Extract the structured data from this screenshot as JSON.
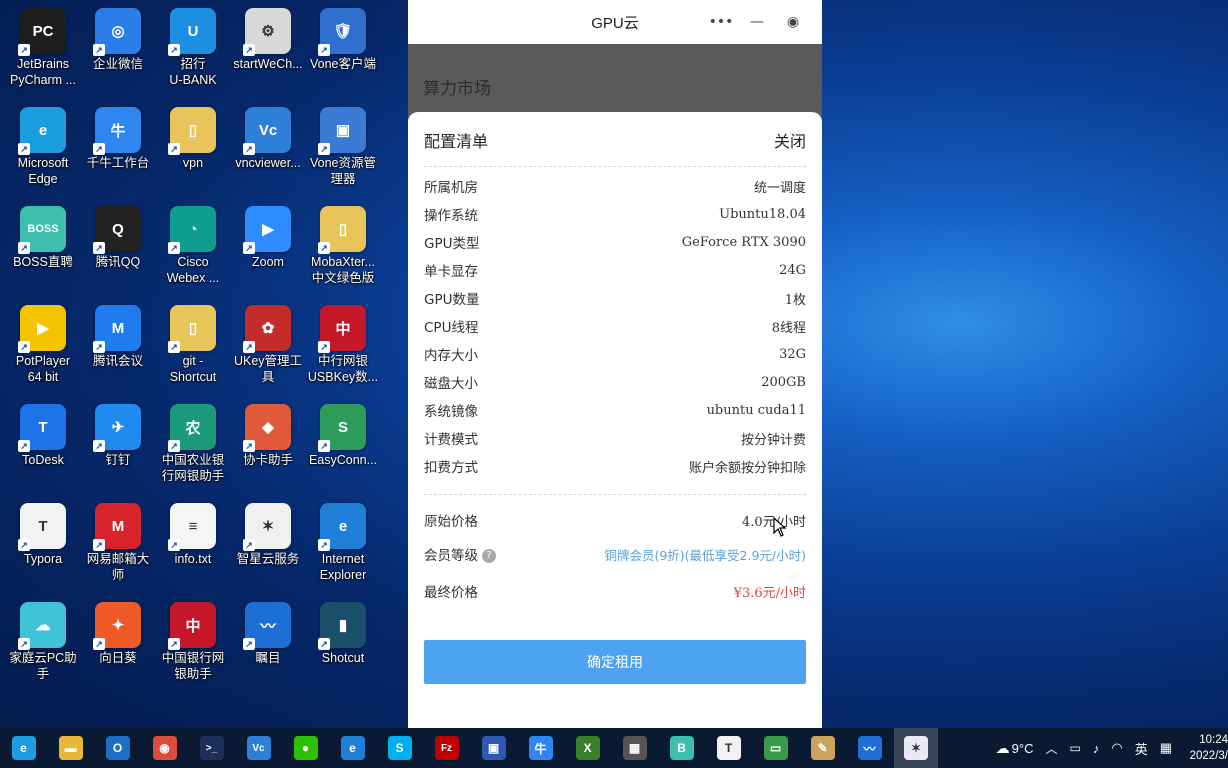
{
  "desktop_icons": [
    {
      "label": "JetBrains\nPyCharm ...",
      "color": "#1e1e1e",
      "glyph": "PC",
      "icon": "pycharm-icon"
    },
    {
      "label": "企业微信",
      "color": "#2b7de9",
      "glyph": "◎",
      "icon": "wecom-icon"
    },
    {
      "label": "招行\nU-BANK",
      "color": "#1d8fe1",
      "glyph": "U",
      "icon": "ubank-icon"
    },
    {
      "label": "startWeCh...",
      "color": "#d8d8d8",
      "glyph": "⚙",
      "icon": "settings-app-icon"
    },
    {
      "label": "Vone客户端",
      "color": "#2e6fcf",
      "glyph": "🛡",
      "icon": "shield-app-icon"
    },
    {
      "label": "Microsoft\nEdge",
      "color": "#1b9de2",
      "glyph": "e",
      "icon": "edge-icon"
    },
    {
      "label": "千牛工作台",
      "color": "#2f86f0",
      "glyph": "牛",
      "icon": "qianniu-icon"
    },
    {
      "label": "vpn",
      "color": "#e8c45a",
      "glyph": "▯",
      "icon": "folder-icon"
    },
    {
      "label": "vncviewer...",
      "color": "#2d7fd8",
      "glyph": "Vc",
      "icon": "vnc-icon"
    },
    {
      "label": "Vone资源管\n理器",
      "color": "#3a7bd5",
      "glyph": "▣",
      "icon": "vone-explorer-icon"
    },
    {
      "label": "BOSS直聘",
      "color": "#3dbfae",
      "glyph": "BOSS",
      "icon": "boss-icon"
    },
    {
      "label": "腾讯QQ",
      "color": "#222222",
      "glyph": "Q",
      "icon": "qq-icon"
    },
    {
      "label": "Cisco\nWebex ...",
      "color": "#0f9d8f",
      "glyph": "◔",
      "icon": "webex-icon"
    },
    {
      "label": "Zoom",
      "color": "#2d8cff",
      "glyph": "▶",
      "icon": "zoom-icon"
    },
    {
      "label": "MobaXter...\n中文绿色版",
      "color": "#e8c45a",
      "glyph": "▯",
      "icon": "folder-icon"
    },
    {
      "label": "PotPlayer\n64 bit",
      "color": "#f5c400",
      "glyph": "▶",
      "icon": "potplayer-icon"
    },
    {
      "label": "腾讯会议",
      "color": "#1e7bf0",
      "glyph": "M",
      "icon": "tencent-meeting-icon"
    },
    {
      "label": "git -\nShortcut",
      "color": "#e8c45a",
      "glyph": "▯",
      "icon": "folder-icon"
    },
    {
      "label": "UKey管理工\n具",
      "color": "#c42b2b",
      "glyph": "✿",
      "icon": "ukey-icon"
    },
    {
      "label": "中行网银\nUSBKey数...",
      "color": "#c4182a",
      "glyph": "中",
      "icon": "boc-icon"
    },
    {
      "label": "ToDesk",
      "color": "#1c74e8",
      "glyph": "T",
      "icon": "todesk-icon"
    },
    {
      "label": "钉钉",
      "color": "#1f8bf0",
      "glyph": "✈",
      "icon": "dingtalk-icon"
    },
    {
      "label": "中国农业银\n行网银助手",
      "color": "#1a9a7a",
      "glyph": "农",
      "icon": "abc-bank-icon"
    },
    {
      "label": "协卡助手",
      "color": "#e05a3a",
      "glyph": "◆",
      "icon": "xieka-icon"
    },
    {
      "label": "EasyConn...",
      "color": "#2d9c5a",
      "glyph": "S",
      "icon": "easyconnect-icon"
    },
    {
      "label": "Typora",
      "color": "#f2f2f2",
      "glyph": "T",
      "icon": "typora-icon"
    },
    {
      "label": "网易邮箱大\n师",
      "color": "#d8232a",
      "glyph": "M",
      "icon": "netease-mail-icon"
    },
    {
      "label": "info.txt",
      "color": "#f5f5f5",
      "glyph": "≡",
      "icon": "text-file-icon"
    },
    {
      "label": "智星云服务",
      "color": "#f0f0f0",
      "glyph": "✶",
      "icon": "zhixing-icon"
    },
    {
      "label": "Internet\nExplorer",
      "color": "#1f7fd6",
      "glyph": "e",
      "icon": "ie-icon"
    },
    {
      "label": "家庭云PC助\n手",
      "color": "#3ec4d6",
      "glyph": "☁",
      "icon": "homecloud-icon"
    },
    {
      "label": "向日葵",
      "color": "#f05a28",
      "glyph": "✦",
      "icon": "sunflower-icon"
    },
    {
      "label": "中国银行网\n银助手",
      "color": "#c4182a",
      "glyph": "中",
      "icon": "boc-helper-icon"
    },
    {
      "label": "瞩目",
      "color": "#1d6fd6",
      "glyph": "〰",
      "icon": "zhumu-icon"
    },
    {
      "label": "Shotcut",
      "color": "#1a4f6a",
      "glyph": "▮",
      "icon": "shotcut-icon"
    }
  ],
  "app": {
    "title": "GPU云",
    "dim_title": "算力市场",
    "sheet": {
      "heading": "配置清单",
      "close": "关闭",
      "specs": [
        {
          "k": "所属机房",
          "v": "统一调度"
        },
        {
          "k": "操作系统",
          "v": "Ubuntu18.04"
        },
        {
          "k": "GPU类型",
          "v": "GeForce RTX 3090"
        },
        {
          "k": "单卡显存",
          "v": "24G"
        },
        {
          "k": "GPU数量",
          "v": "1枚"
        },
        {
          "k": "CPU线程",
          "v": "8线程"
        },
        {
          "k": "内存大小",
          "v": "32G"
        },
        {
          "k": "磁盘大小",
          "v": "200GB"
        },
        {
          "k": "系统镜像",
          "v": "ubuntu cuda11"
        },
        {
          "k": "计费模式",
          "v": "按分钟计费"
        },
        {
          "k": "扣费方式",
          "v": "账户余额按分钟扣除"
        }
      ],
      "original_price_label": "原始价格",
      "original_price": "4.0元/小时",
      "member_label": "会员等级",
      "member_help": "?",
      "member_value": "铜牌会员(9折)(最低享受2.9元/小时)",
      "final_label": "最终价格",
      "final_price": "¥3.6元/小时",
      "confirm": "确定租用"
    }
  },
  "taskbar": {
    "apps": [
      {
        "icon": "edge-taskbar-icon",
        "color": "#1b9de2",
        "glyph": "e"
      },
      {
        "icon": "file-explorer-icon",
        "color": "#e8b83a",
        "glyph": "▬"
      },
      {
        "icon": "outlook-icon",
        "color": "#1a6fc4",
        "glyph": "O"
      },
      {
        "icon": "chrome-icon",
        "color": "#dd4b3e",
        "glyph": "◉"
      },
      {
        "icon": "powershell-icon",
        "color": "#1b2f5a",
        "glyph": ">_"
      },
      {
        "icon": "vnc-taskbar-icon",
        "color": "#2d7fd8",
        "glyph": "Vc"
      },
      {
        "icon": "wechat-icon",
        "color": "#2dc100",
        "glyph": "●"
      },
      {
        "icon": "ie-taskbar-icon",
        "color": "#1f7fd6",
        "glyph": "e"
      },
      {
        "icon": "skype-icon",
        "color": "#00aff0",
        "glyph": "S"
      },
      {
        "icon": "filezilla-icon",
        "color": "#bf0000",
        "glyph": "Fz"
      },
      {
        "icon": "remote-desktop-icon",
        "color": "#2d5ab0",
        "glyph": "▣"
      },
      {
        "icon": "qianniu-taskbar-icon",
        "color": "#2f86f0",
        "glyph": "牛"
      },
      {
        "icon": "xshell-icon",
        "color": "#3a7d2a",
        "glyph": "X"
      },
      {
        "icon": "photo-app-icon",
        "color": "#555555",
        "glyph": "▦"
      },
      {
        "icon": "boss-taskbar-icon",
        "color": "#3dbfae",
        "glyph": "B"
      },
      {
        "icon": "typora-taskbar-icon",
        "color": "#f2f2f2",
        "glyph": "T"
      },
      {
        "icon": "presentation-icon",
        "color": "#3a9a4a",
        "glyph": "▭"
      },
      {
        "icon": "paint-icon",
        "color": "#c9a45a",
        "glyph": "✎"
      },
      {
        "icon": "zhumu-taskbar-icon",
        "color": "#1d6fd6",
        "glyph": "〰"
      }
    ],
    "active_icon": {
      "icon": "gpu-cloud-taskbar-icon",
      "color": "#e9e9f5",
      "glyph": "✶"
    },
    "weather": "9°C",
    "ime": "英",
    "time": "10:24",
    "date": "2022/3/"
  }
}
